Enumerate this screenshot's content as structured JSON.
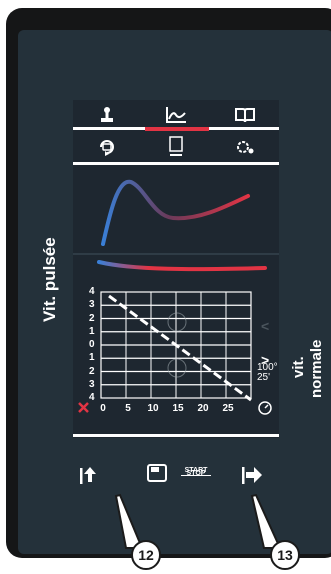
{
  "side_labels": {
    "left": "Vit. pulsée",
    "right_line1": "vit.",
    "right_line2": "normale"
  },
  "tabs_top": [
    {
      "icon": "pressure-gauge-icon"
    },
    {
      "icon": "curve-chart-icon"
    },
    {
      "icon": "book-icon"
    }
  ],
  "tabs_second": [
    {
      "icon": "refresh-cycle-icon"
    },
    {
      "icon": "document-icon"
    },
    {
      "icon": "settings-gear-icon"
    }
  ],
  "graph": {
    "y_ticks_top": [
      "4",
      "3",
      "2",
      "1",
      "0",
      "1",
      "2",
      "3",
      "4"
    ],
    "x_ticks": [
      "0",
      "5",
      "10",
      "15",
      "20",
      "25"
    ],
    "temp_label": "100°",
    "time_label": "25'",
    "next_label": ">",
    "prev_label": "<"
  },
  "bottom": {
    "start_label": "START",
    "stop_label": "STOP"
  },
  "callouts": {
    "left": "12",
    "right": "13"
  },
  "colors": {
    "accent_red": "#e23444",
    "accent_blue": "#3a7fd6",
    "screen_bg": "#1e2730"
  }
}
